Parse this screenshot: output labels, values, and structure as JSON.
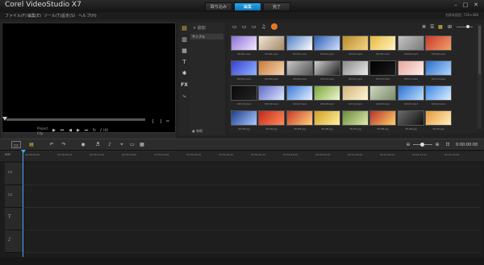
{
  "window": {
    "title": "Corel VideoStudio X7"
  },
  "tabs": [
    {
      "label": "取り込み"
    },
    {
      "label": "編集",
      "active": true
    },
    {
      "label": "完了"
    }
  ],
  "menu": [
    {
      "label": "ファイル(F)"
    },
    {
      "label": "編集(E)"
    },
    {
      "label": "ツール(T)"
    },
    {
      "label": "設定(S)"
    },
    {
      "label": "ヘルプ(H)"
    }
  ],
  "menu_right": "名称未設定, 720×480",
  "player": {
    "mode_project": "Project",
    "mode_clip": "Clip",
    "quality": "HD",
    "timecode": "00:00:00:00"
  },
  "library": {
    "add_label": "追加",
    "sample_label": "サンプル",
    "browse_label": "参照",
    "thumbs": [
      {
        "caption": "SP-I01.mp4",
        "c1": "#8a6fd6",
        "c2": "#f3e9ff"
      },
      {
        "caption": "SP-I02.mp4",
        "c1": "#efe6d6",
        "c2": "#a58a6a"
      },
      {
        "caption": "SP-V01.wmv",
        "c1": "#4f7fc6",
        "c2": "#ffffff"
      },
      {
        "caption": "SP-V02.mp4",
        "c1": "#2f5fb4",
        "c2": "#cfe1ff"
      },
      {
        "caption": "SP-V03.mp4",
        "c1": "#b98b2c",
        "c2": "#f6d585"
      },
      {
        "caption": "SP-V04.wmv",
        "c1": "#e7b93c",
        "c2": "#fff4c4"
      },
      {
        "caption": "SP-V05.mp4",
        "c1": "#c3c3c3",
        "c2": "#7b7b7b"
      },
      {
        "caption": "SP-V06.mp4",
        "c1": "#c93a2a",
        "c2": "#f3a16a"
      },
      {
        "caption": "SP-V07.wmv",
        "c1": "#3a3fd1",
        "c2": "#8db4ff"
      },
      {
        "caption": "SP-V08.mp4",
        "c1": "#c97a3b",
        "c2": "#f3d7b0"
      },
      {
        "caption": "SP-V09.mp4",
        "c1": "#c7c7c7",
        "c2": "#555555"
      },
      {
        "caption": "SP-V10.mp4",
        "c1": "#d0d0d0",
        "c2": "#202020"
      },
      {
        "caption": "SP-V11.mp4",
        "c1": "#8a8a8a",
        "c2": "#eaeaea"
      },
      {
        "caption": "SP-V12.mp4",
        "c1": "#000000",
        "c2": "#1a1a1a"
      },
      {
        "caption": "SP-V13.mp4",
        "c1": "#e7a5a0",
        "c2": "#fff0e8"
      },
      {
        "caption": "SP-V14.mp4",
        "c1": "#2a6fc9",
        "c2": "#b0d6ff"
      },
      {
        "caption": "SP-V15.mp4",
        "c1": "#0a0a0a",
        "c2": "#232323"
      },
      {
        "caption": "SP-V16.mp4",
        "c1": "#5e6bc6",
        "c2": "#dfe7ff"
      },
      {
        "caption": "SP-V17.mp4",
        "c1": "#3a7ad8",
        "c2": "#e7f0ff"
      },
      {
        "caption": "SP-V18.mp4",
        "c1": "#79a63c",
        "c2": "#f0f7cf"
      },
      {
        "caption": "SP-V19.mp4",
        "c1": "#d2b37a",
        "c2": "#fff6d8"
      },
      {
        "caption": "SP-V20.mp4",
        "c1": "#d0d8c0",
        "c2": "#7a8a6c"
      },
      {
        "caption": "SP-V21.mp4",
        "c1": "#2a6fd0",
        "c2": "#bfe0ff"
      },
      {
        "caption": "SP-V22.mp4",
        "c1": "#3a86e6",
        "c2": "#e0f0ff"
      },
      {
        "caption": "SP-I03.jpg",
        "c1": "#1c3e8c",
        "c2": "#aac8ff"
      },
      {
        "caption": "SP-I04.jpg",
        "c1": "#c5281a",
        "c2": "#ff8b5a"
      },
      {
        "caption": "SP-I05.jpg",
        "c1": "#c93a2a",
        "c2": "#ffcf7a"
      },
      {
        "caption": "SP-I06.jpg",
        "c1": "#d2a020",
        "c2": "#fff1a0"
      },
      {
        "caption": "SP-I07.jpg",
        "c1": "#6a8a3a",
        "c2": "#dfe9b0"
      },
      {
        "caption": "SP-I08.jpg",
        "c1": "#b8322a",
        "c2": "#ffd06a"
      },
      {
        "caption": "SP-I09.jpg",
        "c1": "#6a6a6a",
        "c2": "#111111"
      },
      {
        "caption": "SP-I10.jpg",
        "c1": "#e89a3a",
        "c2": "#fff0c0"
      }
    ]
  },
  "toolbar_right": {
    "timecode": "0:00:00:00"
  },
  "ruler": {
    "ticks": [
      "00:00:00:00",
      "00:00:06:02",
      "00:00:12:04",
      "00:00:18:06",
      "00:00:24:08",
      "00:00:30:10",
      "00:00:36:12",
      "00:00:42:14",
      "00:00:48:16",
      "00:00:54:18",
      "00:01:00:20",
      "00:01:06:22",
      "00:01:12:24",
      "00:01:19:00"
    ]
  },
  "track_count": 4
}
